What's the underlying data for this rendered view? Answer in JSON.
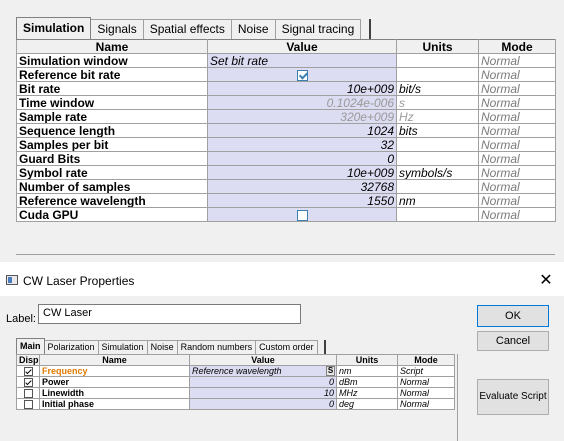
{
  "top_panel": {
    "tabs": [
      "Simulation",
      "Signals",
      "Spatial effects",
      "Noise",
      "Signal tracing"
    ],
    "columns": [
      "Name",
      "Value",
      "Units",
      "Mode"
    ],
    "rows": [
      {
        "name": "Simulation window",
        "value": "Set bit rate",
        "unit": "",
        "mode": "Normal"
      },
      {
        "name": "Reference bit rate",
        "value": "",
        "unit": "",
        "mode": "Normal"
      },
      {
        "name": "Bit rate",
        "value": "10e+009",
        "unit": "bit/s",
        "mode": "Normal"
      },
      {
        "name": "Time window",
        "value": "0.1024e-006",
        "unit": "s",
        "mode": "Normal"
      },
      {
        "name": "Sample rate",
        "value": "320e+009",
        "unit": "Hz",
        "mode": "Normal"
      },
      {
        "name": "Sequence length",
        "value": "1024",
        "unit": "bits",
        "mode": "Normal"
      },
      {
        "name": "Samples per bit",
        "value": "32",
        "unit": "",
        "mode": "Normal"
      },
      {
        "name": "Guard Bits",
        "value": "0",
        "unit": "",
        "mode": "Normal"
      },
      {
        "name": "Symbol rate",
        "value": "10e+009",
        "unit": "symbols/s",
        "mode": "Normal"
      },
      {
        "name": "Number of samples",
        "value": "32768",
        "unit": "",
        "mode": "Normal"
      },
      {
        "name": "Reference wavelength",
        "value": "1550",
        "unit": "nm",
        "mode": "Normal"
      },
      {
        "name": "Cuda GPU",
        "value": "",
        "unit": "",
        "mode": "Normal"
      }
    ],
    "checkboxes": {
      "reference_bit_rate": true,
      "cuda_gpu": false
    }
  },
  "dialog": {
    "title": "CW Laser Properties",
    "close_glyph": "✕",
    "label_caption": "Label:",
    "label_value": "CW Laser",
    "ok": "OK",
    "cancel": "Cancel",
    "evaluate_script": "Evaluate Script",
    "tabs": [
      "Main",
      "Polarization",
      "Simulation",
      "Noise",
      "Random numbers",
      "Custom order"
    ],
    "columns": [
      "Disp",
      "Name",
      "Value",
      "Units",
      "Mode"
    ],
    "rows": [
      {
        "name": "Frequency",
        "value": "Reference wavelength",
        "unit": "nm",
        "mode": "Script",
        "disp": true
      },
      {
        "name": "Power",
        "value": "0",
        "unit": "dBm",
        "mode": "Normal",
        "disp": true
      },
      {
        "name": "Linewidth",
        "value": "10",
        "unit": "MHz",
        "mode": "Normal",
        "disp": false
      },
      {
        "name": "Initial phase",
        "value": "0",
        "unit": "deg",
        "mode": "Normal",
        "disp": false
      }
    ],
    "script_button": "S"
  }
}
